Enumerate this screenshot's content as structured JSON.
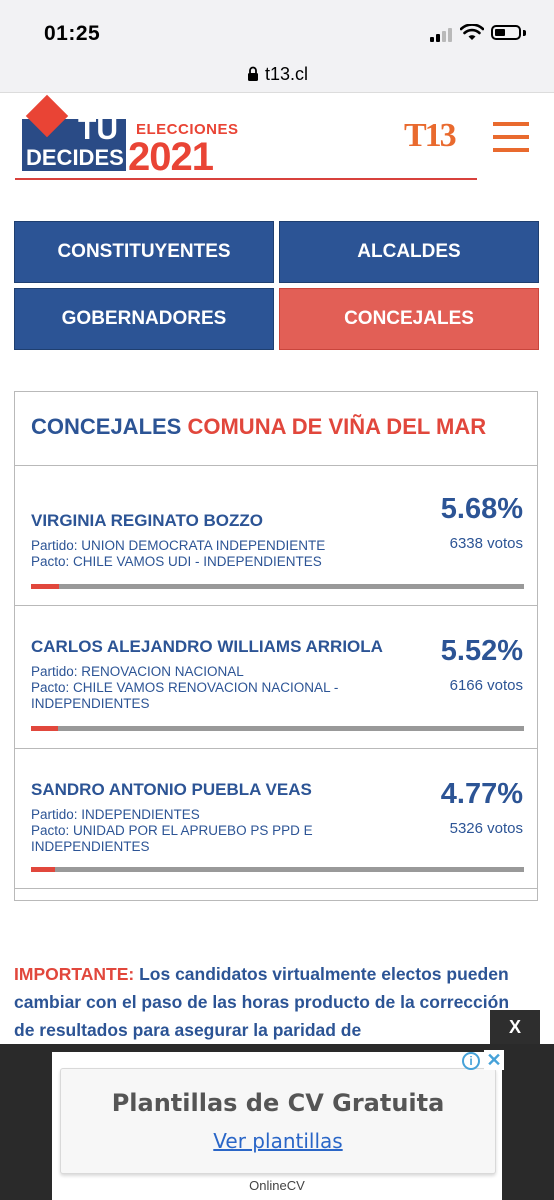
{
  "status_bar": {
    "time": "01:25"
  },
  "browser": {
    "url": "t13.cl"
  },
  "logo": {
    "tu": "TÚ",
    "decides": "DECIDES",
    "elecciones": "ELECCIONES",
    "year": "2021"
  },
  "brand": {
    "t13": "T13"
  },
  "tabs": [
    {
      "label": "CONSTITUYENTES",
      "active": false
    },
    {
      "label": "ALCALDES",
      "active": false
    },
    {
      "label": "GOBERNADORES",
      "active": false
    },
    {
      "label": "CONCEJALES",
      "active": true
    }
  ],
  "results": {
    "title_prefix": "CONCEJALES",
    "title_suffix": "COMUNA DE VIÑA DEL MAR",
    "candidates": [
      {
        "name": "VIRGINIA REGINATO BOZZO",
        "partido": "Partido: UNION DEMOCRATA INDEPENDIENTE",
        "pacto": "Pacto: CHILE VAMOS UDI - INDEPENDIENTES",
        "percent": "5.68%",
        "votes": "6338 votos",
        "share": 0.0568
      },
      {
        "name": "CARLOS ALEJANDRO WILLIAMS ARRIOLA",
        "partido": "Partido: RENOVACION NACIONAL",
        "pacto": "Pacto: CHILE VAMOS RENOVACION NACIONAL - INDEPENDIENTES",
        "percent": "5.52%",
        "votes": "6166 votos",
        "share": 0.0552
      },
      {
        "name": "SANDRO ANTONIO PUEBLA VEAS",
        "partido": "Partido: INDEPENDIENTES",
        "pacto": "Pacto: UNIDAD POR EL APRUEBO PS PPD E INDEPENDIENTES",
        "percent": "4.77%",
        "votes": "5326 votos",
        "share": 0.0477
      }
    ]
  },
  "notice": {
    "label": "IMPORTANTE:",
    "text": "Los candidatos virtualmente electos pueden cambiar con el paso de las horas producto de la corrección de resultados para asegurar la paridad de"
  },
  "ad": {
    "close_label": "X",
    "title": "Plantillas de CV Gratuita",
    "link": "Ver plantillas",
    "brand": "OnlineCV",
    "info_icon": "i",
    "x_icon": "✕"
  },
  "colors": {
    "blue": "#2c5495",
    "red": "#e1473c",
    "orange": "#e96a2e"
  }
}
